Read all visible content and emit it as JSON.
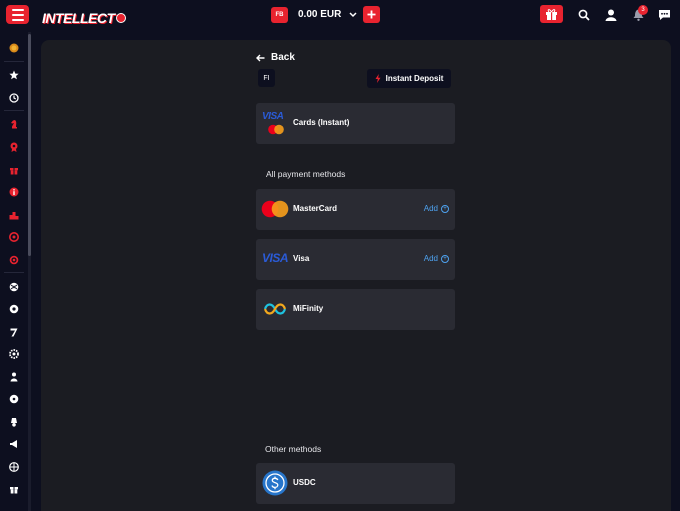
{
  "header": {
    "logo_text": "INTELLECT",
    "wallet_badge": "FB",
    "balance": "0.00 EUR",
    "notification_count": "3"
  },
  "colors": {
    "accent": "#e8232f",
    "link": "#4ea3f1",
    "panel": "#1b1c22",
    "card": "#2a2b33"
  },
  "deposit": {
    "back_label": "Back",
    "country_code": "FI",
    "instant_deposit_label": "Instant Deposit",
    "saved_methods": [
      {
        "name": "Cards (Instant)",
        "icon": "visa-mastercard-icon"
      }
    ],
    "all_methods_title": "All payment methods",
    "all_methods": [
      {
        "name": "MasterCard",
        "icon": "mastercard-icon",
        "action": "Add"
      },
      {
        "name": "Visa",
        "icon": "visa-icon",
        "action": "Add"
      },
      {
        "name": "MiFinity",
        "icon": "mifinity-icon"
      }
    ],
    "other_methods_title": "Other methods",
    "other_methods": [
      {
        "name": "USDC",
        "icon": "usdc-icon"
      }
    ]
  },
  "icon_labels": {
    "visa": "VISA"
  }
}
